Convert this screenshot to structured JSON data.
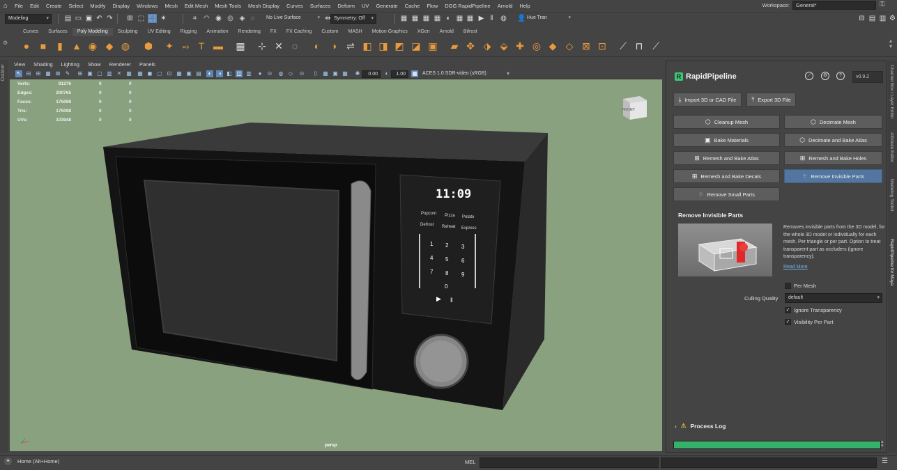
{
  "menubar": {
    "items": [
      "File",
      "Edit",
      "Create",
      "Select",
      "Modify",
      "Display",
      "Windows",
      "Mesh",
      "Edit Mesh",
      "Mesh Tools",
      "Mesh Display",
      "Curves",
      "Surfaces",
      "Deform",
      "UV",
      "Generate",
      "Cache",
      "Flow",
      "DGG RapidPipeline",
      "Arnold",
      "Help"
    ],
    "workspace_label": "Workspace:",
    "workspace_value": "General*"
  },
  "statusline": {
    "mode": "Modeling",
    "live_surface": "No Live Surface",
    "symmetry": "Symmetry: Off",
    "user": "Hue Tran"
  },
  "shelf": {
    "tabs": [
      "Curves",
      "Surfaces",
      "Poly Modeling",
      "Sculpting",
      "UV Editing",
      "Rigging",
      "Animation",
      "Rendering",
      "FX",
      "FX Caching",
      "Custom",
      "MASH",
      "Motion Graphics",
      "XGen",
      "Arnold",
      "Bifrost"
    ],
    "active_tab": "Poly Modeling"
  },
  "outliner_label": "Outliner",
  "viewport": {
    "menu": [
      "View",
      "Shading",
      "Lighting",
      "Show",
      "Renderer",
      "Panels"
    ],
    "exposure": "0.00",
    "gamma": "1.00",
    "color_space": "ACES 1.0 SDR-video (sRGB)",
    "hud": [
      {
        "label": "Verts:",
        "v1": "81276",
        "v2": "0",
        "v3": "0"
      },
      {
        "label": "Edges:",
        "v1": "200765",
        "v2": "0",
        "v3": "0"
      },
      {
        "label": "Faces:",
        "v1": "175098",
        "v2": "0",
        "v3": "0"
      },
      {
        "label": "Tris:",
        "v1": "175098",
        "v2": "0",
        "v3": "0"
      },
      {
        "label": "UVs:",
        "v1": "103948",
        "v2": "0",
        "v3": "0"
      }
    ],
    "viewcube_label": "FRONT",
    "camera": "persp",
    "microwave": {
      "clock": "11:09",
      "row1": [
        "Popcorn",
        "Pizza",
        "Potato"
      ],
      "row2": [
        "Defrost",
        "Reheat",
        "Express"
      ],
      "keys": [
        "1",
        "2",
        "3",
        "4",
        "5",
        "6",
        "7",
        "8",
        "9",
        "0"
      ]
    }
  },
  "panel": {
    "title": "RapidPipeline",
    "version": "v0.9.2",
    "import_label": "Import 3D or CAD File",
    "export_label": "Export 3D File",
    "buttons": [
      "Cleanup Mesh",
      "Decimate Mesh",
      "Bake Materials",
      "Decimate and Bake Atlas",
      "Remesh and Bake Atlas",
      "Remesh and Bake Holes",
      "Remesh and Bake Decals",
      "Remove Invisible Parts",
      "Remove Small Parts"
    ],
    "selected_button": "Remove Invisible Parts",
    "section_title": "Remove Invisible Parts",
    "description": "Removes invisible parts from the 3D model, for the whole 3D model or individually for each mesh. Per triangle or per part. Option to treat transparent part as occluders (ignore transparency).",
    "read_more": "Read More",
    "per_mesh_label": "Per Mesh",
    "per_mesh_checked": false,
    "culling_label": "Culling Quality",
    "culling_value": "default",
    "ignore_transparency_label": "Ignore Transparency",
    "ignore_transparency_checked": true,
    "visibility_per_part_label": "Visibility Per Part",
    "visibility_per_part_checked": true,
    "process_log_label": "Process Log",
    "progress": 1.0,
    "accent": "#37b06a",
    "selected_color": "#52769f"
  },
  "side_tabs": [
    "Channel Box / Layer Editor",
    "Attribute Editor",
    "Modeling Toolkit",
    "RapidPipeline for Maya"
  ],
  "bottom": {
    "help_text": "Home (Alt+Home)",
    "mel_label": "MEL"
  }
}
